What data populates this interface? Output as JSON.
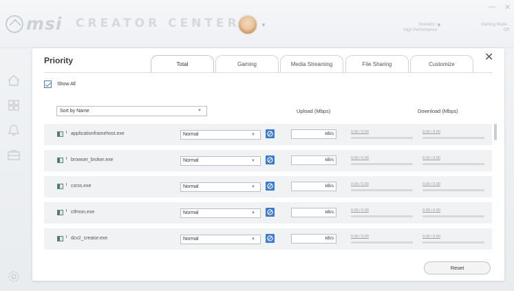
{
  "app": {
    "brand": "msi",
    "title": "CREATOR CENTER"
  },
  "header": {
    "scenario_label": "Scenario :",
    "scenario_value": "High Performance",
    "gaming_mode_label": "Gaming Mode :",
    "gaming_mode_value": "Off"
  },
  "window_controls": {
    "minimize": "—",
    "close": "✕"
  },
  "modal": {
    "title": "Priority",
    "close": "✕",
    "tabs": [
      {
        "label": "Total",
        "active": true
      },
      {
        "label": "Gaming",
        "active": false
      },
      {
        "label": "Media Streaming",
        "active": false
      },
      {
        "label": "File Sharing",
        "active": false
      },
      {
        "label": "Customize",
        "active": false
      }
    ],
    "show_all": {
      "label": "Show All",
      "checked": true
    },
    "sort": {
      "value": "Sort by Name"
    },
    "columns": {
      "upload": "Upload (Mbps)",
      "download": "Download (Mbps)"
    },
    "rows": [
      {
        "name": "applicationframehost.exe",
        "priority": "Normal",
        "rate_unit": "kB/s",
        "upload": "0.00 / 0.00",
        "download": "0.00 / 0.00"
      },
      {
        "name": "browser_broker.exe",
        "priority": "Normal",
        "rate_unit": "kB/s",
        "upload": "0.00 / 0.00",
        "download": "0.00 / 0.00"
      },
      {
        "name": "csrss.exe",
        "priority": "Normal",
        "rate_unit": "kB/s",
        "upload": "0.00 / 0.00",
        "download": "0.00 / 0.00"
      },
      {
        "name": "ctfmon.exe",
        "priority": "Normal",
        "rate_unit": "kB/s",
        "upload": "0.00 / 0.00",
        "download": "0.00 / 0.00"
      },
      {
        "name": "dcv2_creator.exe",
        "priority": "Normal",
        "rate_unit": "kB/s",
        "upload": "0.00 / 0.00",
        "download": "0.00 / 0.00"
      }
    ],
    "reset_label": "Reset"
  },
  "colors": {
    "accent": "#3a7bd5",
    "row_bg": "#f1f2f3",
    "modal_bg": "#ffffff"
  },
  "sidebar_icons": [
    "home-icon",
    "apps-grid-icon",
    "bell-icon",
    "briefcase-icon",
    "settings-gear-icon"
  ]
}
